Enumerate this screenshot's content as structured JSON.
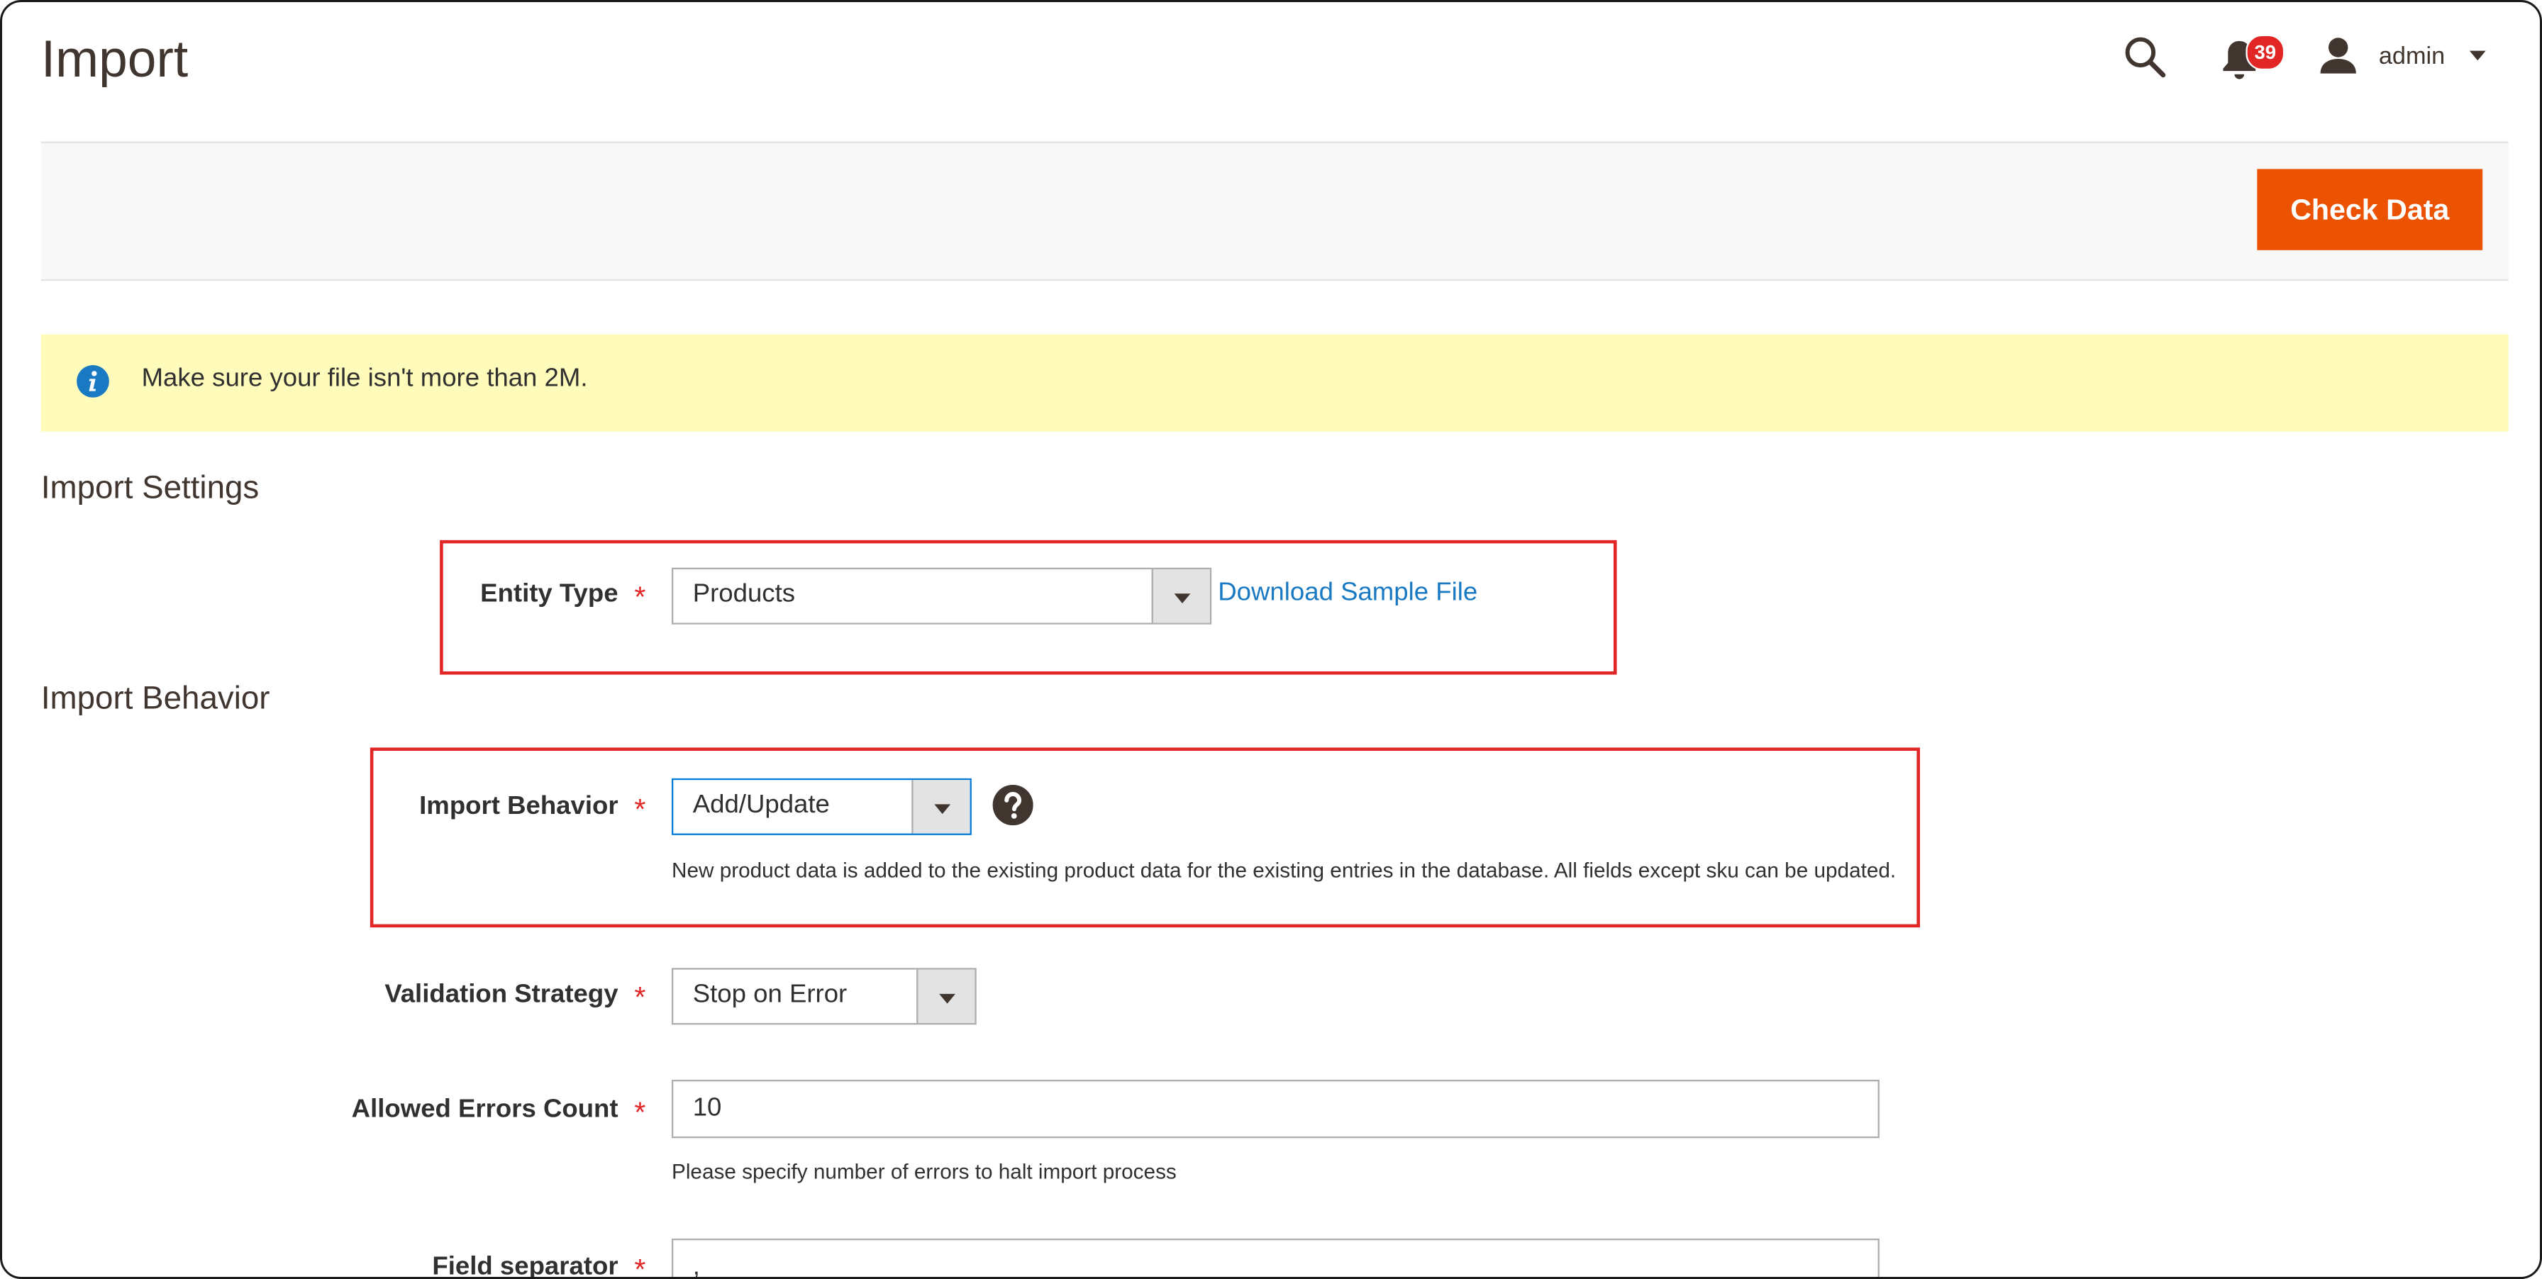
{
  "header": {
    "title": "Import",
    "notifications_count": "39",
    "user_name": "admin"
  },
  "actions": {
    "check_data_label": "Check Data"
  },
  "message": {
    "text": "Make sure your file isn't more than 2M."
  },
  "import_settings": {
    "title": "Import Settings",
    "entity_type": {
      "label": "Entity Type",
      "value": "Products",
      "sample_link": "Download Sample File"
    }
  },
  "import_behavior": {
    "title": "Import Behavior",
    "behavior": {
      "label": "Import Behavior",
      "value": "Add/Update",
      "note": "New product data is added to the existing product data for the existing entries in the database. All fields except sku can be updated."
    },
    "validation": {
      "label": "Validation Strategy",
      "value": "Stop on Error"
    },
    "allowed_errors": {
      "label": "Allowed Errors Count",
      "value": "10",
      "note": "Please specify number of errors to halt import process"
    },
    "field_separator": {
      "label": "Field separator",
      "value": ","
    }
  },
  "required_mark": "*",
  "colors": {
    "accent": "#eb5202",
    "link": "#1979c3",
    "highlight_box": "#e22626",
    "message_bg": "#fffbbb"
  }
}
